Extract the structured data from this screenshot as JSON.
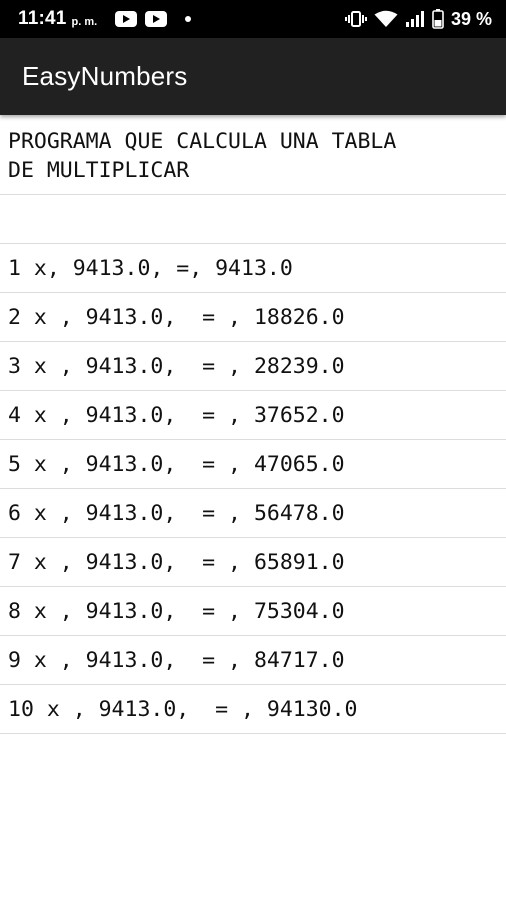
{
  "status_bar": {
    "time": "11:41",
    "ampm": "p. m.",
    "battery_text": "39 %",
    "icons": [
      "youtube-icon",
      "youtube-icon",
      "notification-dot-icon",
      "vibrate-icon",
      "wifi-icon",
      "signal-icon",
      "battery-icon"
    ]
  },
  "app_bar": {
    "title": "EasyNumbers"
  },
  "list": {
    "header": "PROGRAMA QUE CALCULA UNA TABLA\nDE MULTIPLICAR",
    "empty": "",
    "rows": [
      "1 x, 9413.0, =, 9413.0",
      "2 x , 9413.0,  = , 18826.0",
      "3 x , 9413.0,  = , 28239.0",
      "4 x , 9413.0,  = , 37652.0",
      "5 x , 9413.0,  = , 47065.0",
      "6 x , 9413.0,  = , 56478.0",
      "7 x , 9413.0,  = , 65891.0",
      "8 x , 9413.0,  = , 75304.0",
      "9 x , 9413.0,  = , 84717.0",
      "10 x , 9413.0,  = , 94130.0"
    ]
  }
}
